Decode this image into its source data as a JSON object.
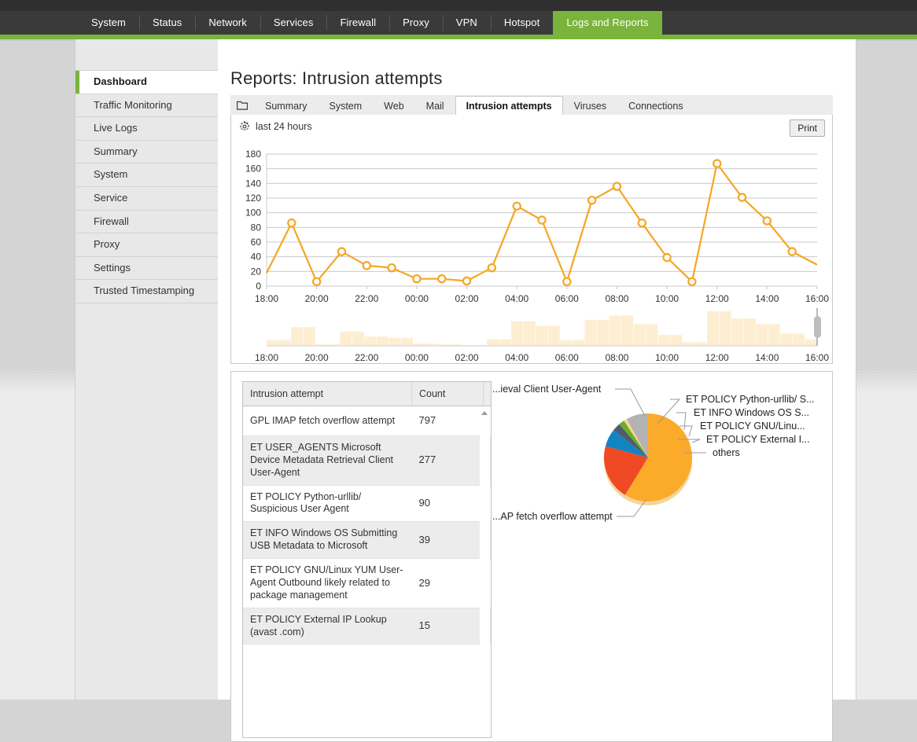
{
  "topnav": {
    "items": [
      {
        "label": "System",
        "active": false
      },
      {
        "label": "Status",
        "active": false
      },
      {
        "label": "Network",
        "active": false
      },
      {
        "label": "Services",
        "active": false
      },
      {
        "label": "Firewall",
        "active": false
      },
      {
        "label": "Proxy",
        "active": false
      },
      {
        "label": "VPN",
        "active": false
      },
      {
        "label": "Hotspot",
        "active": false
      },
      {
        "label": "Logs and Reports",
        "active": true
      }
    ],
    "accent_color": "#7ab43c"
  },
  "sidebar": {
    "items": [
      {
        "label": "Dashboard",
        "active": true
      },
      {
        "label": "Traffic Monitoring",
        "active": false
      },
      {
        "label": "Live Logs",
        "active": false
      },
      {
        "label": "Summary",
        "active": false
      },
      {
        "label": "System",
        "active": false
      },
      {
        "label": "Service",
        "active": false
      },
      {
        "label": "Firewall",
        "active": false
      },
      {
        "label": "Proxy",
        "active": false
      },
      {
        "label": "Settings",
        "active": false
      },
      {
        "label": "Trusted Timestamping",
        "active": false
      }
    ]
  },
  "page": {
    "title": "Reports: Intrusion attempts"
  },
  "tabs": {
    "folder_icon": "folder-icon",
    "items": [
      {
        "label": "Summary",
        "active": false
      },
      {
        "label": "System",
        "active": false
      },
      {
        "label": "Web",
        "active": false
      },
      {
        "label": "Mail",
        "active": false
      },
      {
        "label": "Intrusion attempts",
        "active": true
      },
      {
        "label": "Viruses",
        "active": false
      },
      {
        "label": "Connections",
        "active": false
      }
    ]
  },
  "toolbar": {
    "gear_icon": "gear-icon",
    "range_label": "last 24 hours",
    "print_label": "Print"
  },
  "chart_data": [
    {
      "type": "line",
      "title": "",
      "xlabel": "",
      "ylabel": "",
      "ylim": [
        0,
        180
      ],
      "yticks": [
        0,
        20,
        40,
        60,
        80,
        100,
        120,
        140,
        160,
        180
      ],
      "grid": true,
      "legend": "none",
      "line_color": "#f5a623",
      "marker": "open-circle",
      "x": [
        "18:00",
        "19:00",
        "20:00",
        "21:00",
        "22:00",
        "23:00",
        "00:00",
        "01:00",
        "02:00",
        "03:00",
        "04:00",
        "05:00",
        "06:00",
        "07:00",
        "08:00",
        "09:00",
        "10:00",
        "11:00",
        "12:00",
        "13:00",
        "14:00",
        "15:00",
        "16:00"
      ],
      "xtick_labels": [
        "18:00",
        "20:00",
        "22:00",
        "00:00",
        "02:00",
        "04:00",
        "06:00",
        "08:00",
        "10:00",
        "12:00",
        "14:00",
        "16:00"
      ],
      "values": [
        18,
        86,
        6,
        47,
        28,
        25,
        10,
        10,
        7,
        25,
        109,
        90,
        6,
        117,
        136,
        86,
        39,
        6,
        167,
        121,
        89,
        47,
        29
      ]
    },
    {
      "type": "bar",
      "title": "",
      "xlabel": "",
      "ylabel": "",
      "grid": false,
      "legend": "none",
      "bar_color": "#fdeed2",
      "xtick_labels": [
        "18:00",
        "20:00",
        "22:00",
        "00:00",
        "02:00",
        "04:00",
        "06:00",
        "08:00",
        "10:00",
        "12:00",
        "14:00",
        "16:00"
      ],
      "categories": [
        "18:00",
        "18:30",
        "19:00",
        "19:30",
        "20:00",
        "20:30",
        "21:00",
        "21:30",
        "22:00",
        "22:30",
        "23:00",
        "23:30",
        "00:00",
        "00:30",
        "01:00",
        "01:30",
        "02:00",
        "02:30",
        "03:00",
        "03:30",
        "04:00",
        "04:30",
        "05:00",
        "05:30",
        "06:00",
        "06:30",
        "07:00",
        "07:30",
        "08:00",
        "08:30",
        "09:00",
        "09:30",
        "10:00",
        "10:30",
        "11:00",
        "11:30",
        "12:00",
        "12:30",
        "13:00",
        "13:30",
        "14:00",
        "14:30",
        "15:00",
        "15:30"
      ],
      "values": [
        8,
        8,
        26,
        26,
        2,
        2,
        20,
        20,
        13,
        13,
        11,
        11,
        3,
        3,
        2,
        2,
        1,
        1,
        9,
        9,
        34,
        34,
        28,
        28,
        8,
        8,
        36,
        36,
        42,
        42,
        30,
        30,
        15,
        15,
        5,
        5,
        48,
        48,
        38,
        38,
        30,
        30,
        17,
        17,
        9
      ]
    },
    {
      "type": "pie",
      "title": "",
      "legend": "callout-labels",
      "labels": [
        "...ieval Client User-Agent",
        "ET POLICY Python-urllib/ S...",
        "ET INFO Windows OS S...",
        "ET POLICY GNU/Linu...",
        "ET POLICY External I...",
        "others",
        "...AP fetch overflow attempt"
      ],
      "slices": [
        {
          "label": "GPL IMAP fetch overflow attempt",
          "value": 797,
          "color": "#fbaa2a"
        },
        {
          "label": "ET USER_AGENTS Microsoft Device Metadata Retrieval Client User-Agent",
          "value": 277,
          "color": "#ef4a23"
        },
        {
          "label": "ET POLICY Python-urllib/ Suspicious User Agent",
          "value": 90,
          "color": "#1284c4"
        },
        {
          "label": "ET INFO Windows OS Submitting USB Metadata to Microsoft",
          "value": 39,
          "color": "#525c69"
        },
        {
          "label": "ET POLICY GNU/Linux YUM User-Agent Outbound likely related to package management",
          "value": 29,
          "color": "#69b02a"
        },
        {
          "label": "ET POLICY External IP Lookup (avast .com)",
          "value": 15,
          "color": "#fcd79a"
        },
        {
          "label": "others",
          "value": 110,
          "color": "#b3b3b3"
        }
      ]
    }
  ],
  "table": {
    "headers": [
      "Intrusion attempt",
      "Count",
      "",
      ""
    ],
    "rows": [
      {
        "name": "GPL IMAP fetch overflow attempt",
        "count": "797",
        "color": "#fbaa2a"
      },
      {
        "name": "ET USER_AGENTS Microsoft Device Metadata Retrieval Client User-Agent",
        "count": "277",
        "color": "#ef4a23"
      },
      {
        "name": "ET POLICY Python-urllib/ Suspicious User Agent",
        "count": "90",
        "color": "#1284c4"
      },
      {
        "name": "ET INFO Windows OS Submitting USB Metadata to Microsoft",
        "count": "39",
        "color": "#525c69"
      },
      {
        "name": "ET POLICY GNU/Linux YUM User-Agent Outbound likely related to package management",
        "count": "29",
        "color": "#69b02a"
      },
      {
        "name": "ET POLICY External IP Lookup (avast .com)",
        "count": "15",
        "color": "#fcd79a"
      }
    ]
  }
}
